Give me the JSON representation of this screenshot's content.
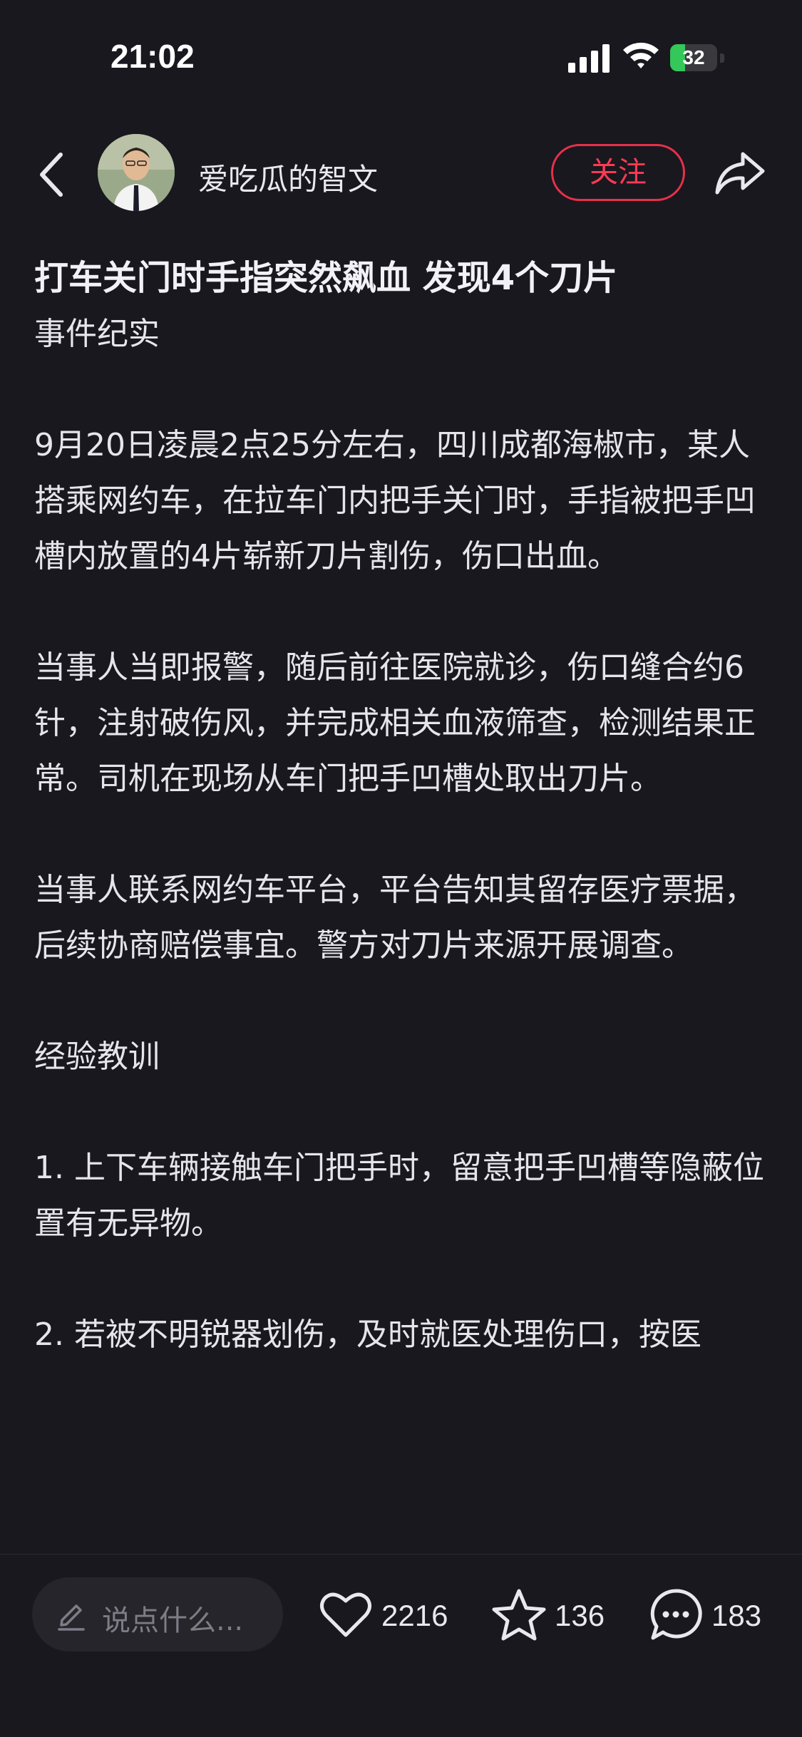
{
  "status_bar": {
    "time": "21:02",
    "battery_level": "32",
    "battery_fraction": 0.32
  },
  "header": {
    "author_name": "爱吃瓜的智文",
    "follow_label": "关注",
    "icons": [
      "back-icon",
      "avatar",
      "share-icon"
    ]
  },
  "article": {
    "title": "打车关门时手指突然飙血 发现4个刀片",
    "paragraphs": [
      "事件纪实",
      "",
      "9月20日凌晨2点25分左右，四川成都海椒市，某人搭乘网约车，在拉车门内把手关门时，手指被把手凹槽内放置的4片崭新刀片割伤，伤口出血。",
      "",
      "当事人当即报警，随后前往医院就诊，伤口缝合约6针，注射破伤风，并完成相关血液筛查，检测结果正常。司机在现场从车门把手凹槽处取出刀片。",
      "",
      "当事人联系网约车平台，平台告知其留存医疗票据，后续协商赔偿事宜。警方对刀片来源开展调查。",
      "",
      "经验教训",
      "",
      "1. 上下车辆接触车门把手时，留意把手凹槽等隐蔽位置有无异物。",
      "",
      "2. 若被不明锐器划伤，及时就医处理伤口，按医"
    ]
  },
  "bottom_bar": {
    "comment_placeholder": "说点什么...",
    "like_count": "2216",
    "favorite_count": "136",
    "comment_count": "183"
  },
  "colors": {
    "background": "#19181e",
    "accent": "#ff3a55",
    "text": "#e9e8ee",
    "battery": "#34c759"
  }
}
